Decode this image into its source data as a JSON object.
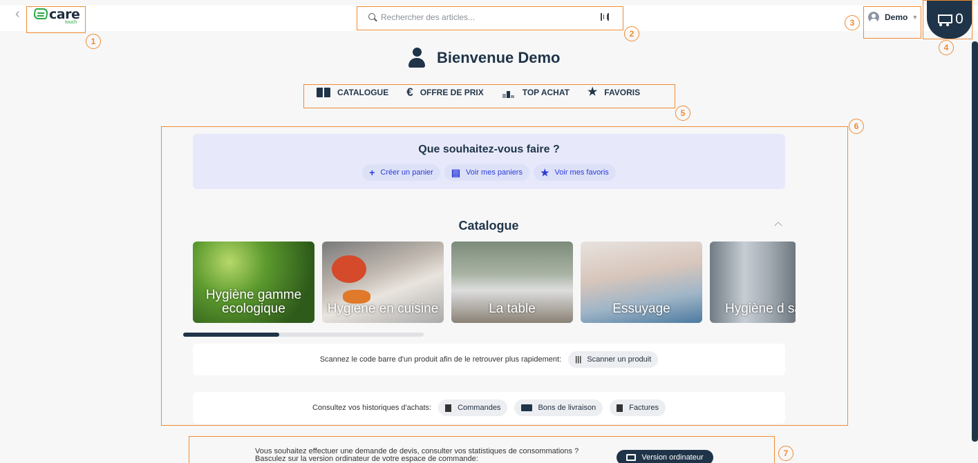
{
  "header": {
    "back_icon": "chevron-left-icon",
    "logo_text": "care",
    "logo_sub": "touch",
    "search_placeholder": "Rechercher des articles...",
    "user_name": "Demo",
    "cart_count": "0"
  },
  "welcome": {
    "title": "Bienvenue Demo"
  },
  "nav": {
    "items": [
      {
        "label": "CATALOGUE",
        "icon": "book-icon"
      },
      {
        "label": "OFFRE DE PRIX",
        "icon": "euro-icon"
      },
      {
        "label": "TOP ACHAT",
        "icon": "podium-icon"
      },
      {
        "label": "FAVORIS",
        "icon": "star-icon"
      }
    ]
  },
  "actions": {
    "title": "Que souhaitez-vous faire ?",
    "buttons": [
      {
        "label": "Créer un panier",
        "icon": "plus-icon"
      },
      {
        "label": "Voir mes paniers",
        "icon": "cart-icon"
      },
      {
        "label": "Voir mes favoris",
        "icon": "star-icon"
      }
    ]
  },
  "catalogue": {
    "title": "Catalogue",
    "cards": [
      {
        "label": "Hygiène gamme ecologique"
      },
      {
        "label": "Hygiène en cuisine"
      },
      {
        "label": "La table"
      },
      {
        "label": "Essuyage"
      },
      {
        "label": "Hygiène d sanitaire"
      }
    ],
    "scroll_progress": 0.4
  },
  "scan": {
    "text": "Scannez le code barre d'un produit afin de le retrouver plus rapidement:",
    "button": "Scanner un produit"
  },
  "history": {
    "text": "Consultez vos historiques d'achats:",
    "buttons": [
      {
        "label": "Commandes",
        "icon": "document-icon"
      },
      {
        "label": "Bons de livraison",
        "icon": "truck-icon"
      },
      {
        "label": "Factures",
        "icon": "invoice-icon"
      }
    ]
  },
  "footer": {
    "line1": "Vous souhaitez effectuer une demande de devis, consulter vos statistiques de consommations ?",
    "line2": "Basculez sur la version ordinateur de votre espace de commande:",
    "button": "Version ordinateur"
  },
  "annotations": [
    "1",
    "2",
    "3",
    "4",
    "5",
    "6",
    "7"
  ],
  "colors": {
    "accent": "#f08a30",
    "primary": "#1f3448",
    "link": "#2b3bd6",
    "panel": "#e7e9fb"
  }
}
